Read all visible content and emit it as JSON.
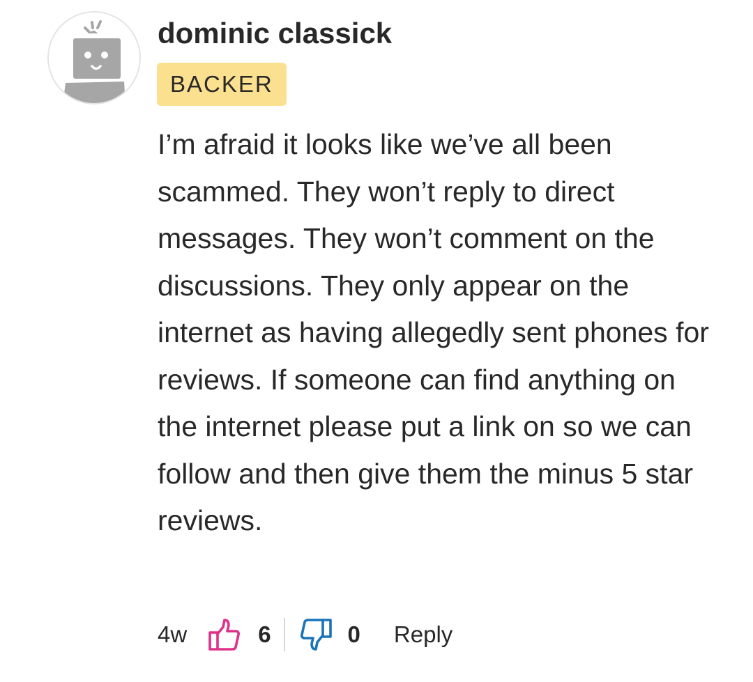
{
  "comment": {
    "author": "dominic classick",
    "badge": "BACKER",
    "avatar_icon": "robot-avatar-icon",
    "body": "I’m afraid it looks like we’ve all been scammed. They won’t reply to direct messages. They won’t comment on the discussions. They only appear on the internet as having allegedly sent phones for reviews. If someone can find anything on the internet please put a link on so we can follow and then give them the minus 5 star reviews.",
    "time": "4w",
    "likes": "6",
    "dislikes": "0",
    "reply_label": "Reply"
  },
  "colors": {
    "badge_bg": "#fbe08f",
    "like_icon": "#e0318a",
    "dislike_icon": "#1a73b8",
    "avatar_gray": "#a6a6a6"
  },
  "icons": {
    "like": "thumbs-up-icon",
    "dislike": "thumbs-down-icon"
  }
}
